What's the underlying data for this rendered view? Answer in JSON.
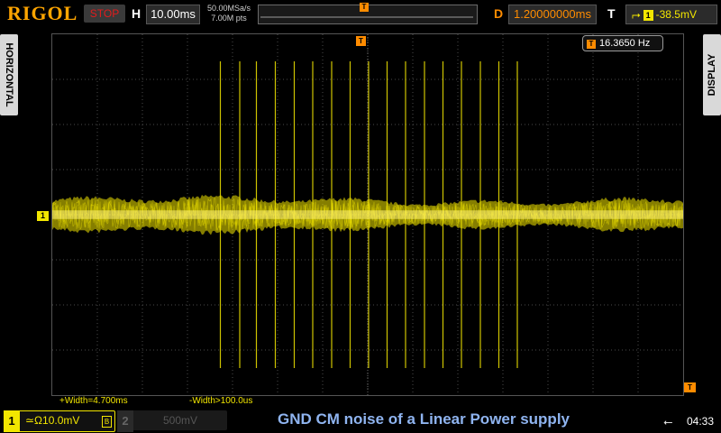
{
  "header": {
    "brand": "RIGOL",
    "run_state": "STOP",
    "horizontal_label": "H",
    "timebase": "10.00ms",
    "sample_rate": "50.00MSa/s",
    "memory_depth": "7.00M pts",
    "trigger_pos_glyph": "T",
    "delay_label": "D",
    "delay_value": "1.20000000ms",
    "trigger_label": "T",
    "trigger_edge": "⮣",
    "trigger_channel": "1",
    "trigger_level": "-38.5mV"
  },
  "side_tabs": {
    "left": "HORIZONTAL",
    "right": "DISPLAY"
  },
  "plot": {
    "frequency_counter": "16.3650 Hz",
    "frequency_icon": "T",
    "ch1_marker": "1",
    "trigger_marker": "T",
    "trigger_level_marker": "T",
    "pos_width": "+Width=4.700ms",
    "neg_width": "-Width>100.0us",
    "colors": {
      "ch1": "#f2e600",
      "grid": "#4a4a4a",
      "trigger": "#ff8c00"
    }
  },
  "chart_data": {
    "type": "line",
    "series": [
      {
        "values": [
          0
        ],
        "color": "#f2e600",
        "noise_band_divisions": 0.8,
        "spike_times_ms": [
          -32.7,
          -28.4,
          -24.7,
          -20.5,
          -16.3,
          -12.2,
          -8.0,
          -3.9,
          0.2,
          4.3,
          8.4,
          12.6,
          16.7,
          20.8,
          25.0,
          29.1,
          33.2
        ],
        "spike_height_divisions": 3.4
      }
    ],
    "x_divisions": 14,
    "y_divisions": 8,
    "grid": true
  },
  "footer": {
    "ch1_number": "1",
    "ch1_coupling": "≃Ω",
    "ch1_scale": "10.0mV",
    "ch1_bw": "B",
    "ch2_number": "2",
    "ch2_scale": "500mV",
    "caption": "GND CM noise of a Linear Power supply",
    "usb_icon": "⭠",
    "time": "04:33"
  }
}
